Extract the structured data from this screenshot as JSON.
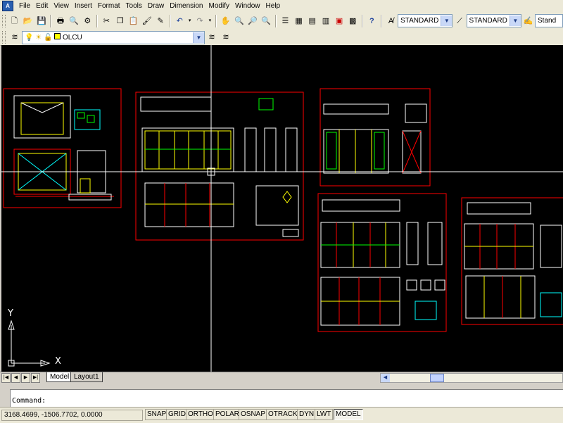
{
  "menu": {
    "items": [
      "File",
      "Edit",
      "View",
      "Insert",
      "Format",
      "Tools",
      "Draw",
      "Dimension",
      "Modify",
      "Window",
      "Help"
    ]
  },
  "toolbar": {
    "text_style": "STANDARD",
    "dim_style": "STANDARD",
    "table_style": "Stand"
  },
  "layers": {
    "current_layer": "OLCU"
  },
  "tabs": {
    "model": "Model",
    "layout1": "Layout1"
  },
  "ucs": {
    "y_label": "Y",
    "x_label": "X"
  },
  "command": {
    "prompt": "Command:"
  },
  "status": {
    "coordinates": "3168.4699, -1506.7702, 0.0000",
    "buttons": [
      "SNAP",
      "GRID",
      "ORTHO",
      "POLAR",
      "OSNAP",
      "OTRACK",
      "DYN",
      "LWT",
      "MODEL"
    ]
  },
  "colors": {
    "canvas": "#000000",
    "frame": "#ff0000",
    "lines_yellow": "#ffff00",
    "lines_green": "#00ff00",
    "lines_cyan": "#00ffff",
    "lines_white": "#ffffff"
  }
}
